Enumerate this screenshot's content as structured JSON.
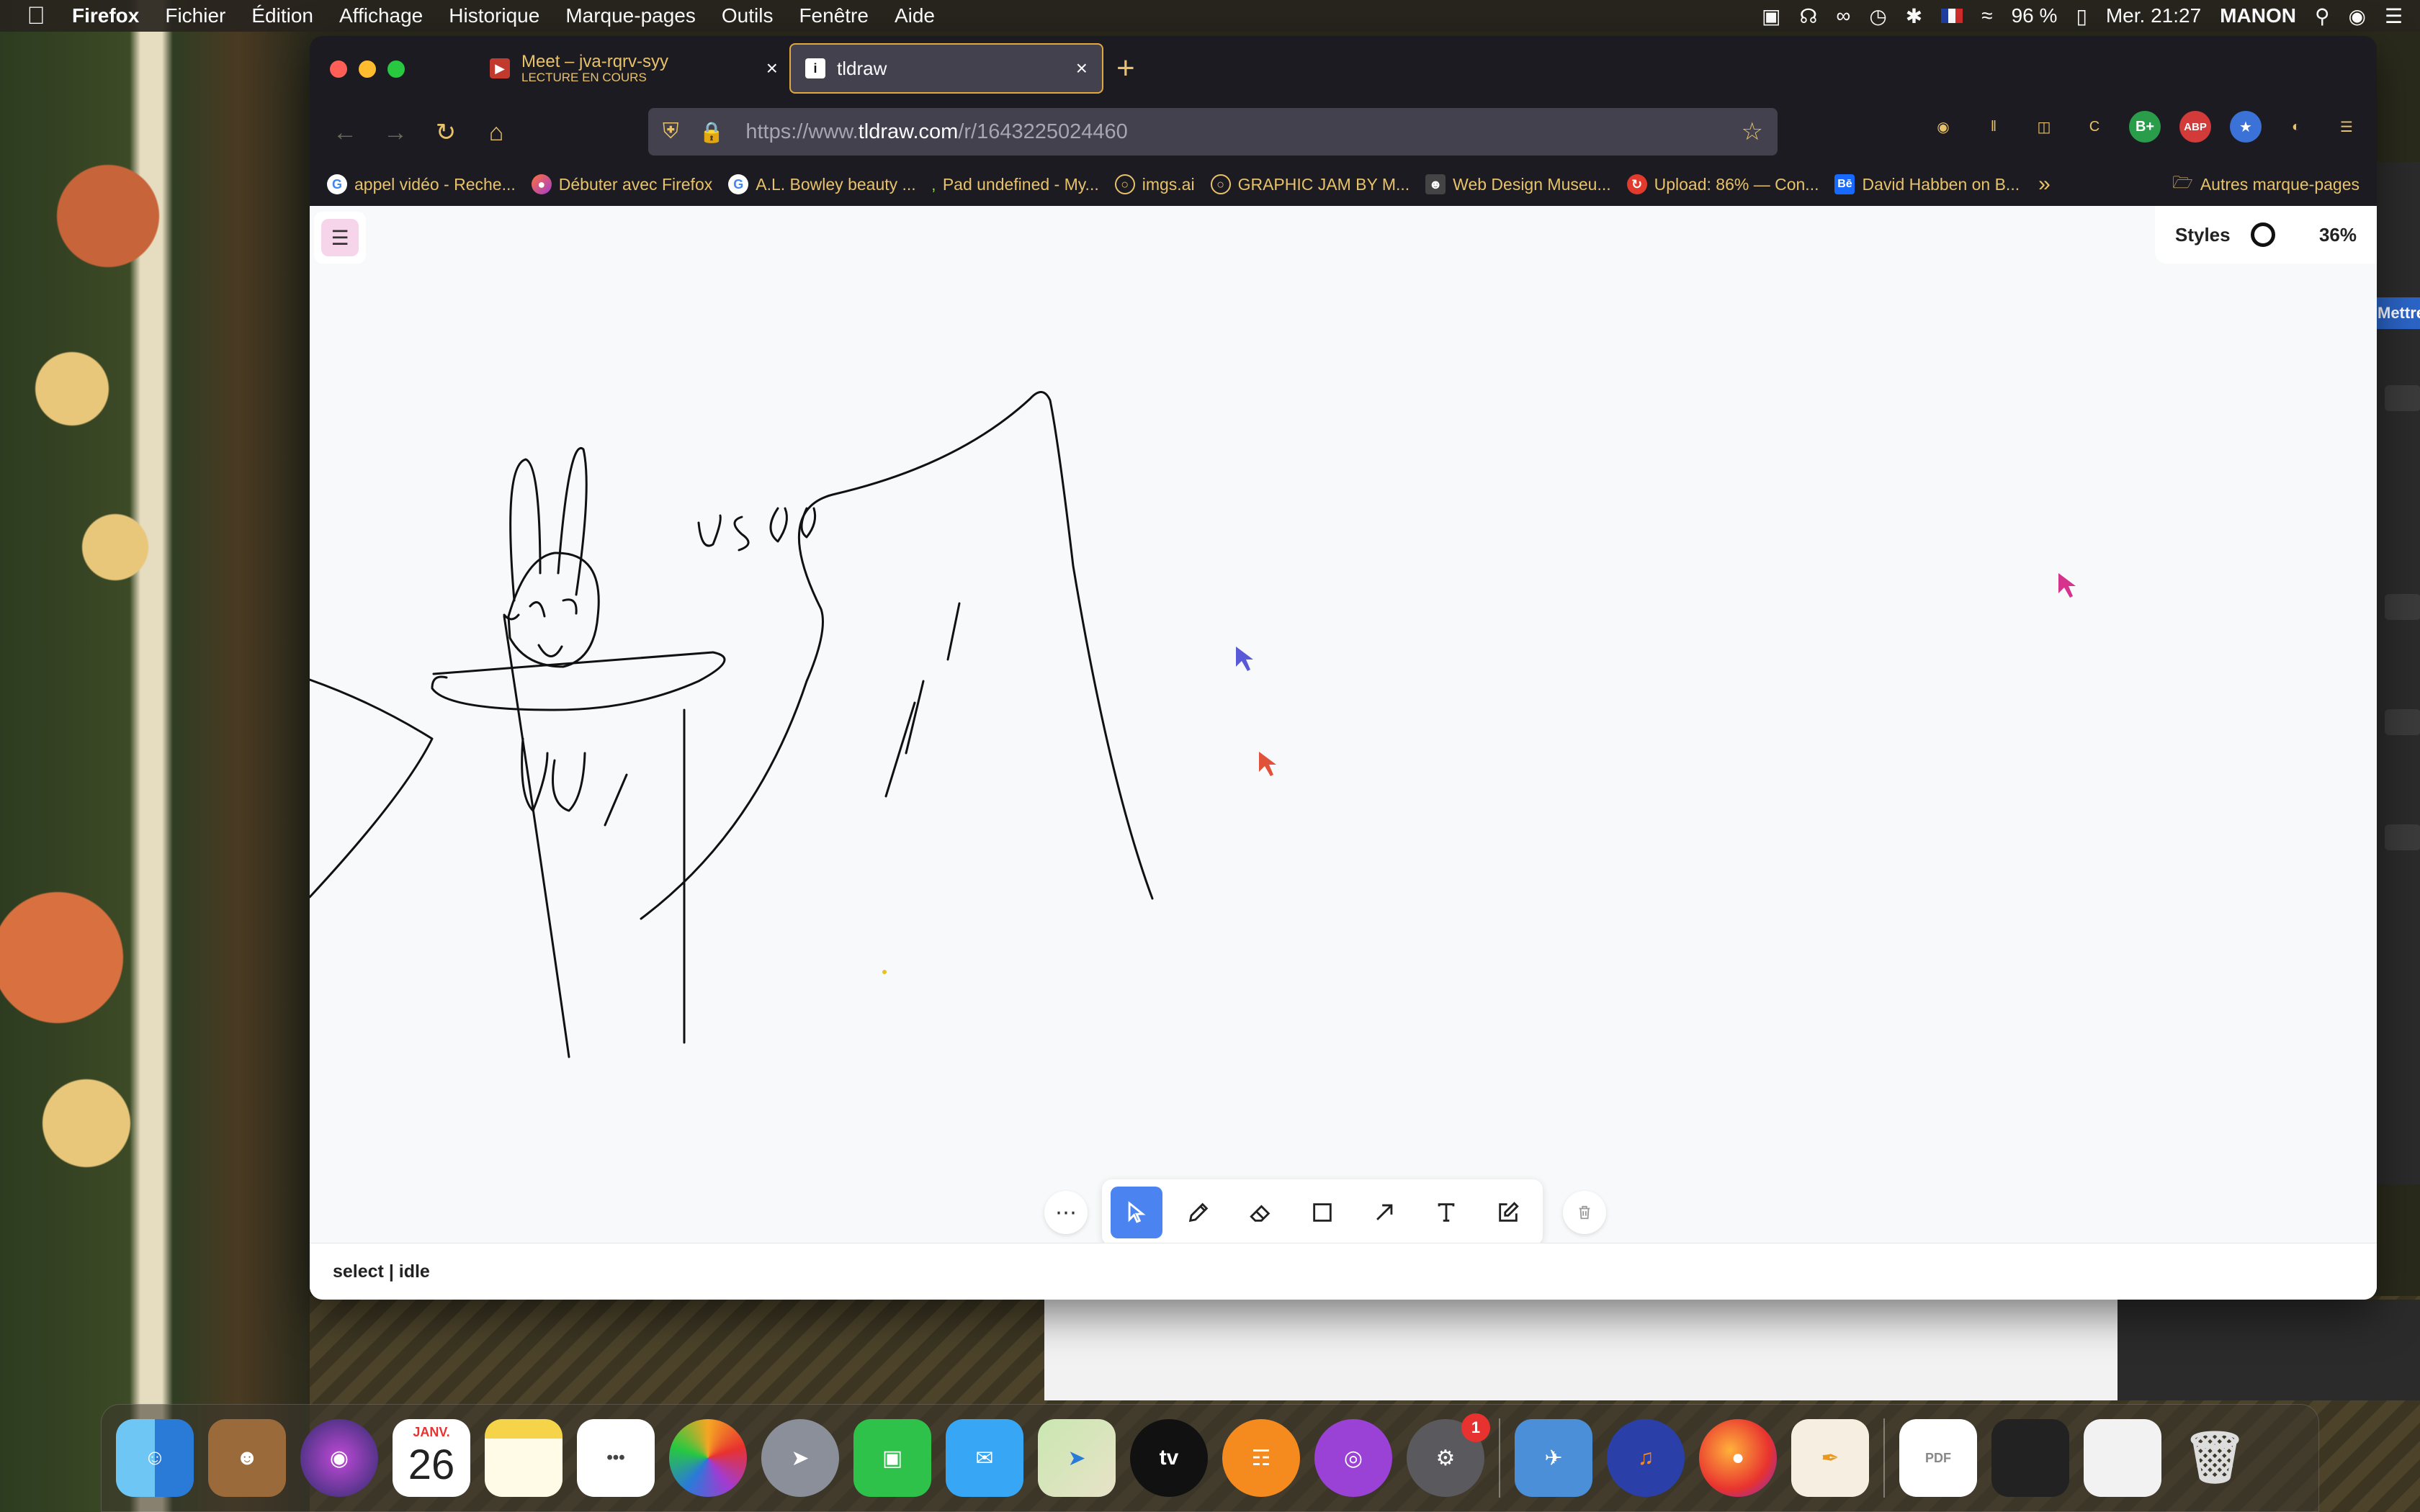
{
  "menubar": {
    "app_name": "Firefox",
    "menus": [
      "Fichier",
      "Édition",
      "Affichage",
      "Historique",
      "Marque-pages",
      "Outils",
      "Fenêtre",
      "Aide"
    ],
    "battery": "96 %",
    "clock": "Mer. 21:27",
    "user": "MANON"
  },
  "tabs": {
    "meet_title": "Meet – jva-rqrv-syy",
    "meet_subtitle": "LECTURE EN COURS",
    "tldraw_title": "tldraw"
  },
  "navbar": {
    "url_prefix": "https://www.",
    "url_domain": "tldraw.com",
    "url_path": "/r/1643225024460"
  },
  "bookmarks": [
    {
      "label": "appel vidéo - Reche...",
      "icon": "google-icon"
    },
    {
      "label": "Débuter avec Firefox",
      "icon": "firefox-icon"
    },
    {
      "label": "A.L. Bowley beauty ...",
      "icon": "google-icon"
    },
    {
      "label": "Pad undefined - My...",
      "icon": "pad-icon"
    },
    {
      "label": "imgs.ai",
      "icon": "globe-icon"
    },
    {
      "label": "GRAPHIC JAM BY M...",
      "icon": "globe-icon"
    },
    {
      "label": "Web Design Museu...",
      "icon": "user-icon"
    },
    {
      "label": "Upload: 86% — Con...",
      "icon": "upload-icon"
    },
    {
      "label": "David Habben on B...",
      "icon": "behance-icon"
    }
  ],
  "bookmarks_folder": "Autres marque-pages",
  "tldraw": {
    "styles_label": "Styles",
    "zoom": "36%",
    "status": "select | idle",
    "canvas_text": "US 00"
  },
  "bg_window": {
    "button_label": "Mettre"
  },
  "dock": {
    "calendar_month": "JANV.",
    "calendar_day": "26",
    "settings_badge": "1"
  },
  "colors": {
    "firefox_accent": "#e7c26b",
    "tldraw_select": "#4b84f0",
    "cursor_blue": "#5a5ad8",
    "cursor_red": "#e0523a",
    "cursor_pink": "#d6338c"
  }
}
